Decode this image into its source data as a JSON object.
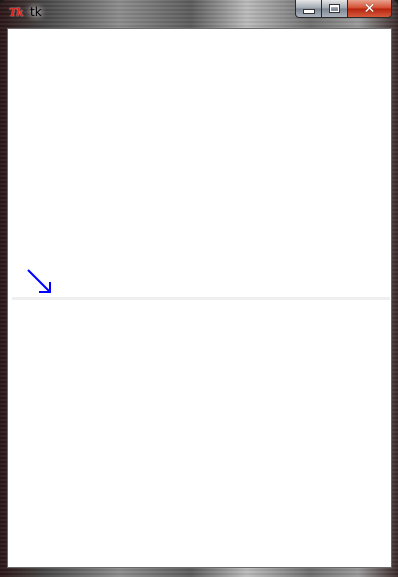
{
  "window": {
    "title": "tk",
    "icon": "tk-feather-icon"
  },
  "caption_buttons": {
    "minimize": "minimize-icon",
    "maximize": "maximize-icon",
    "close": "close-icon",
    "close_glyph": "✕"
  },
  "app_icon_text": "Tk",
  "canvas": {
    "background": "#ffffff",
    "arrow_color": "#0000ff",
    "divider_color": "#efefef"
  }
}
